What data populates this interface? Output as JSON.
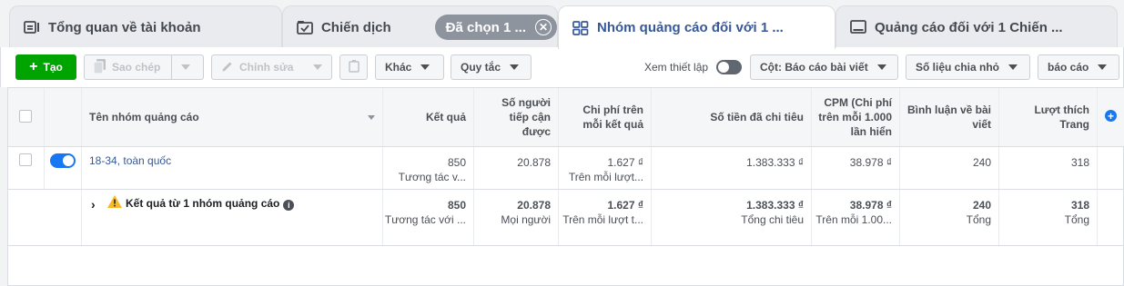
{
  "tabs": [
    {
      "label": "Tổng quan về tài khoản",
      "icon": "account-overview-icon"
    },
    {
      "label": "Chiến dịch",
      "icon": "campaign-check-icon",
      "chip": "Đã chọn 1 ..."
    },
    {
      "label": "Nhóm quảng cáo đối với 1 ...",
      "icon": "ad-set-grid-icon"
    },
    {
      "label": "Quảng cáo đối với 1 Chiến ...",
      "icon": "ad-monitor-icon"
    }
  ],
  "toolbar": {
    "create": "Tạo",
    "copy": "Sao chép",
    "edit": "Chỉnh sửa",
    "more": "Khác",
    "rules": "Quy tắc",
    "view_setup": "Xem thiết lập",
    "columns": "Cột: Báo cáo bài viết",
    "breakdown": "Số liệu chia nhỏ",
    "reports": "báo cáo"
  },
  "table": {
    "headers": {
      "name": "Tên nhóm quảng cáo",
      "results": "Kết quả",
      "reach": "Số người tiếp cận được",
      "cost_per_result": "Chi phí trên mỗi kết quả",
      "amount_spent": "Số tiền đã chi tiêu",
      "cpm": "CPM (Chi phí trên mỗi 1.000 lần hiển",
      "post_comments": "Bình luận về bài viết",
      "page_likes": "Lượt thích Trang"
    },
    "rows": [
      {
        "name": "18-34, toàn quốc",
        "status": "on",
        "results": "850",
        "results_sub": "Tương tác v...",
        "reach": "20.878",
        "cost_per_result": "1.627 ₫",
        "cost_per_result_sub": "Trên mỗi lượt...",
        "amount_spent": "1.383.333 ₫",
        "cpm": "38.978 ₫",
        "post_comments": "240",
        "page_likes": "318"
      }
    ],
    "summary": {
      "name": "Kết quả từ 1 nhóm quảng cáo",
      "results": "850",
      "results_sub": "Tương tác với ...",
      "reach": "20.878",
      "reach_sub": "Mọi người",
      "cost_per_result": "1.627 ₫",
      "cost_per_result_sub": "Trên mỗi lượt t...",
      "amount_spent": "1.383.333 ₫",
      "amount_spent_sub": "Tổng chi tiêu",
      "cpm": "38.978 ₫",
      "cpm_sub": "Trên mỗi 1.00...",
      "post_comments": "240",
      "post_comments_sub": "Tổng",
      "page_likes": "318",
      "page_likes_sub": "Tổng"
    }
  },
  "colors": {
    "accent": "#1877f2",
    "create_green": "#00a400",
    "link": "#385898",
    "warning": "#f7b928"
  }
}
